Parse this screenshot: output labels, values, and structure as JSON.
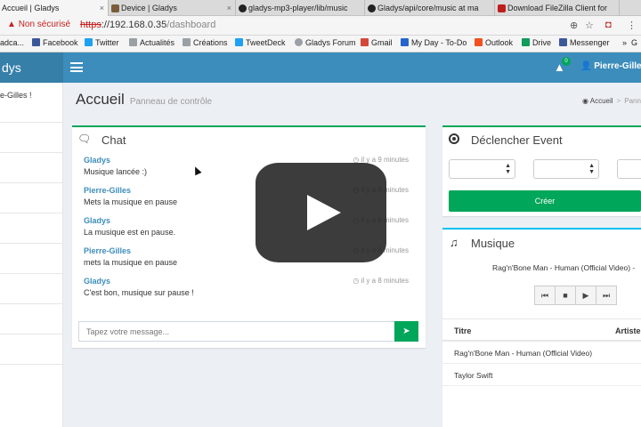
{
  "browser": {
    "tabs": [
      {
        "title": "Accueil | Gladys",
        "active": true
      },
      {
        "title": "Device | Gladys"
      },
      {
        "title": "gladys-mp3-player/lib/music"
      },
      {
        "title": "Gladys/api/core/music at ma"
      },
      {
        "title": "Download FileZilla Client for"
      }
    ],
    "security_warning": "Non sécurisé",
    "url_scheme": "https",
    "url_host": "://192.168.0.35",
    "url_path": "/dashboard",
    "bookmarks": [
      "adca...",
      "Facebook",
      "Twitter",
      "Actualités",
      "Créations",
      "TweetDeck",
      "Gladys Forum",
      "Gmail",
      "My Day - To-Do",
      "Outlook",
      "Drive",
      "Messenger",
      "»",
      "G"
    ]
  },
  "app": {
    "logo": "dys",
    "notification_count": "0",
    "user_name": "Pierre-Gilles",
    "sidebar_welcome": "e-Gilles !"
  },
  "page": {
    "title": "Accueil",
    "subtitle": "Panneau de contrôle",
    "breadcrumb_home": "Accueil",
    "breadcrumb_sep": ">",
    "breadcrumb_current": "Panne"
  },
  "chat": {
    "title": "Chat",
    "input_placeholder": "Tapez votre message...",
    "messages": [
      {
        "author": "Gladys",
        "text": "Musique lancée :)",
        "time": "il y a 9 minutes"
      },
      {
        "author": "Pierre-Gilles",
        "text": "Mets la musique en pause",
        "time": "il y a 8 minutes"
      },
      {
        "author": "Gladys",
        "text": "La musique est en pause.",
        "time": "il y a 8 minutes"
      },
      {
        "author": "Pierre-Gilles",
        "text": "mets la musique en pause",
        "time": "il y a 8 minutes"
      },
      {
        "author": "Gladys",
        "text": "C'est bon, musique sur pause !",
        "time": "il y a 8 minutes"
      }
    ]
  },
  "event": {
    "title": "Déclencher Event",
    "create_label": "Créer"
  },
  "music": {
    "title": "Musique",
    "now_playing": "Rag'n'Bone Man - Human (Official Video) -",
    "col_title": "Titre",
    "col_artist": "Artiste",
    "tracks": [
      {
        "title": "Rag'n'Bone Man - Human (Official Video)"
      },
      {
        "title": "Taylor Swift"
      }
    ]
  },
  "colors": {
    "header": "#3c8dbc",
    "logo_bg": "#367fa9",
    "accent_green": "#00a65a",
    "music_border": "#00c0ef"
  }
}
